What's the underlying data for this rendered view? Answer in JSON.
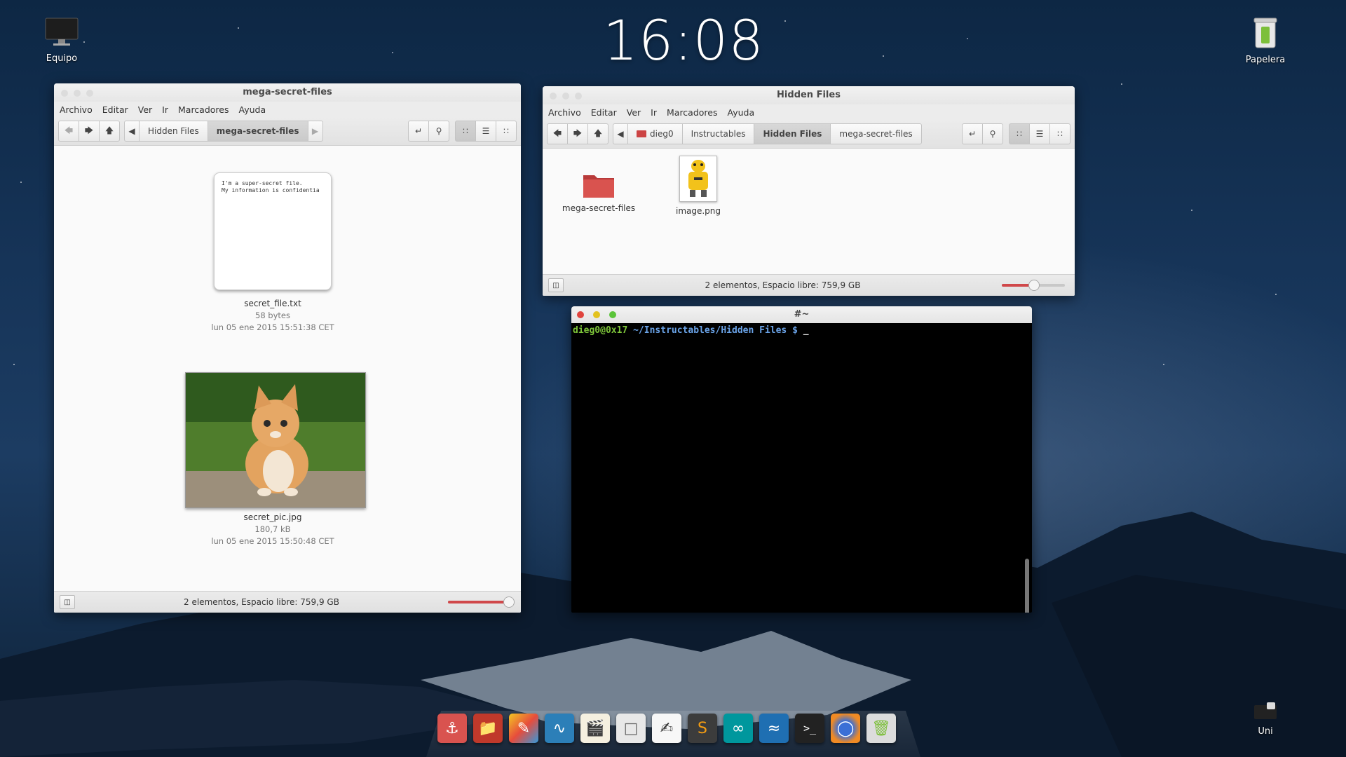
{
  "desktop": {
    "clock": "16:08",
    "icons": {
      "computer": "Equipo",
      "trash": "Papelera",
      "uni": "Uni"
    }
  },
  "fm_left": {
    "title": "mega-secret-files",
    "menu": [
      "Archivo",
      "Editar",
      "Ver",
      "Ir",
      "Marcadores",
      "Ayuda"
    ],
    "breadcrumbs": [
      "Hidden Files",
      "mega-secret-files"
    ],
    "active_crumb": "mega-secret-files",
    "files": [
      {
        "name": "secret_file.txt",
        "size": "58 bytes",
        "date": "lun 05 ene 2015 15:51:38 CET",
        "preview_line1": "I'm a super-secret file.",
        "preview_line2": "My information is confidentia"
      },
      {
        "name": "secret_pic.jpg",
        "size": "180,7 kB",
        "date": "lun 05 ene 2015 15:50:48 CET"
      }
    ],
    "status": "2 elementos, Espacio libre: 759,9 GB",
    "zoom_fraction": 0.95
  },
  "fm_right": {
    "title": "Hidden Files",
    "menu": [
      "Archivo",
      "Editar",
      "Ver",
      "Ir",
      "Marcadores",
      "Ayuda"
    ],
    "breadcrumbs": [
      "dieg0",
      "Instructables",
      "Hidden Files",
      "mega-secret-files"
    ],
    "active_crumb": "Hidden Files",
    "files": [
      {
        "name": "mega-secret-files",
        "type": "folder-icon"
      },
      {
        "name": "image.png",
        "type": "image-icon"
      }
    ],
    "status": "2 elementos, Espacio libre: 759,9 GB",
    "zoom_fraction": 0.5
  },
  "terminal": {
    "title": "#~",
    "prompt_user": "dieg0@0x17",
    "prompt_path": "~/Instructables/Hidden Files $",
    "cursor": "_"
  },
  "dock": {
    "items": [
      "anchor-icon",
      "folder-icon",
      "paint-icon",
      "system-monitor-icon",
      "clapper-icon",
      "blank-doc-icon",
      "text-editor-icon",
      "sublime-icon",
      "arduino-icon",
      "wireshark-icon",
      "terminal-icon",
      "firefox-icon",
      "trash-icon"
    ]
  },
  "colors": {
    "accent": "#d0484a",
    "term_user": "#7ec63a",
    "term_path": "#6aa3e8"
  }
}
